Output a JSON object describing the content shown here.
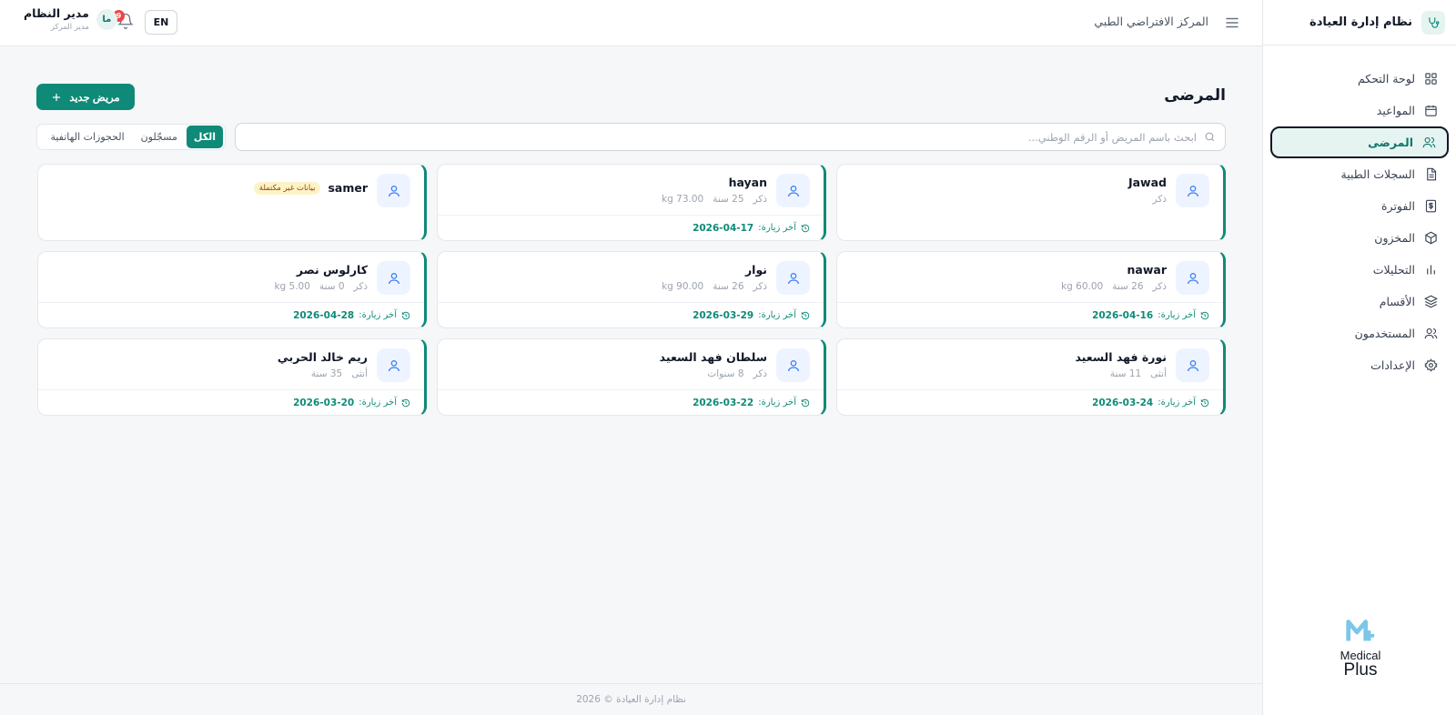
{
  "brand": {
    "title": "نظام إدارة العيادة"
  },
  "sidebar": {
    "items": [
      {
        "label": "لوحة التحكم",
        "icon": "dashboard-icon",
        "active": false
      },
      {
        "label": "المواعيد",
        "icon": "calendar-icon",
        "active": false
      },
      {
        "label": "المرضى",
        "icon": "patients-icon",
        "active": true
      },
      {
        "label": "السجلات الطبية",
        "icon": "document-icon",
        "active": false
      },
      {
        "label": "الفوترة",
        "icon": "invoice-icon",
        "active": false
      },
      {
        "label": "المخزون",
        "icon": "box-icon",
        "active": false
      },
      {
        "label": "التحليلات",
        "icon": "bar-chart-icon",
        "active": false
      },
      {
        "label": "الأقسام",
        "icon": "layers-icon",
        "active": false
      },
      {
        "label": "المستخدمون",
        "icon": "users-icon",
        "active": false
      },
      {
        "label": "الإعدادات",
        "icon": "gear-icon",
        "active": false
      }
    ],
    "logo": {
      "line1": "Medical",
      "line2": "Plus"
    }
  },
  "header": {
    "center_name": "المركز الافتراضي الطبي",
    "language_button": "EN",
    "notifications_count": "9",
    "user": {
      "initials": "ما",
      "name": "مدير النظام",
      "role": "مدير المركز"
    }
  },
  "page": {
    "title": "المرضى",
    "new_patient_button": "مريض جديد",
    "search_placeholder": "ابحث باسم المريض أو الرقم الوطني...",
    "filters": [
      {
        "label": "الكل",
        "active": true
      },
      {
        "label": "مسجّلون",
        "active": false
      },
      {
        "label": "الحجوزات الهاتفية",
        "active": false
      }
    ],
    "last_visit_label": "آخر زيارة:"
  },
  "patients": [
    {
      "name": "Jawad",
      "gender": "ذكر",
      "age": "",
      "weight": "",
      "last_visit": "",
      "badge": ""
    },
    {
      "name": "hayan",
      "gender": "ذكر",
      "age": "25 سنة",
      "weight": "kg 73.00",
      "last_visit": "2026-04-17",
      "badge": ""
    },
    {
      "name": "samer",
      "gender": "",
      "age": "",
      "weight": "",
      "last_visit": "",
      "badge": "بيانات غير مكتملة"
    },
    {
      "name": "nawar",
      "gender": "ذكر",
      "age": "26 سنة",
      "weight": "kg 60.00",
      "last_visit": "2026-04-16",
      "badge": ""
    },
    {
      "name": "نوار",
      "gender": "ذكر",
      "age": "26 سنة",
      "weight": "kg 90.00",
      "last_visit": "2026-03-29",
      "badge": ""
    },
    {
      "name": "كارلوس نصر",
      "gender": "ذكر",
      "age": "0 سنة",
      "weight": "kg 5.00",
      "last_visit": "2026-04-28",
      "badge": ""
    },
    {
      "name": "نورة فهد السعيد",
      "gender": "أنثى",
      "age": "11 سنة",
      "weight": "",
      "last_visit": "2026-03-24",
      "badge": ""
    },
    {
      "name": "سلطان فهد السعيد",
      "gender": "ذكر",
      "age": "8 سنوات",
      "weight": "",
      "last_visit": "2026-03-22",
      "badge": ""
    },
    {
      "name": "ريم خالد الحربي",
      "gender": "أنثى",
      "age": "35 سنة",
      "weight": "",
      "last_visit": "2026-03-20",
      "badge": ""
    }
  ],
  "footer": {
    "text": "نظام إدارة العيادة © 2026"
  },
  "colors": {
    "primary": "#0f8a78",
    "active_bg": "#e6f4f1",
    "icon_blue": "#3b82f6",
    "badge_bg": "#fef3c7",
    "notification": "#ef4444"
  }
}
